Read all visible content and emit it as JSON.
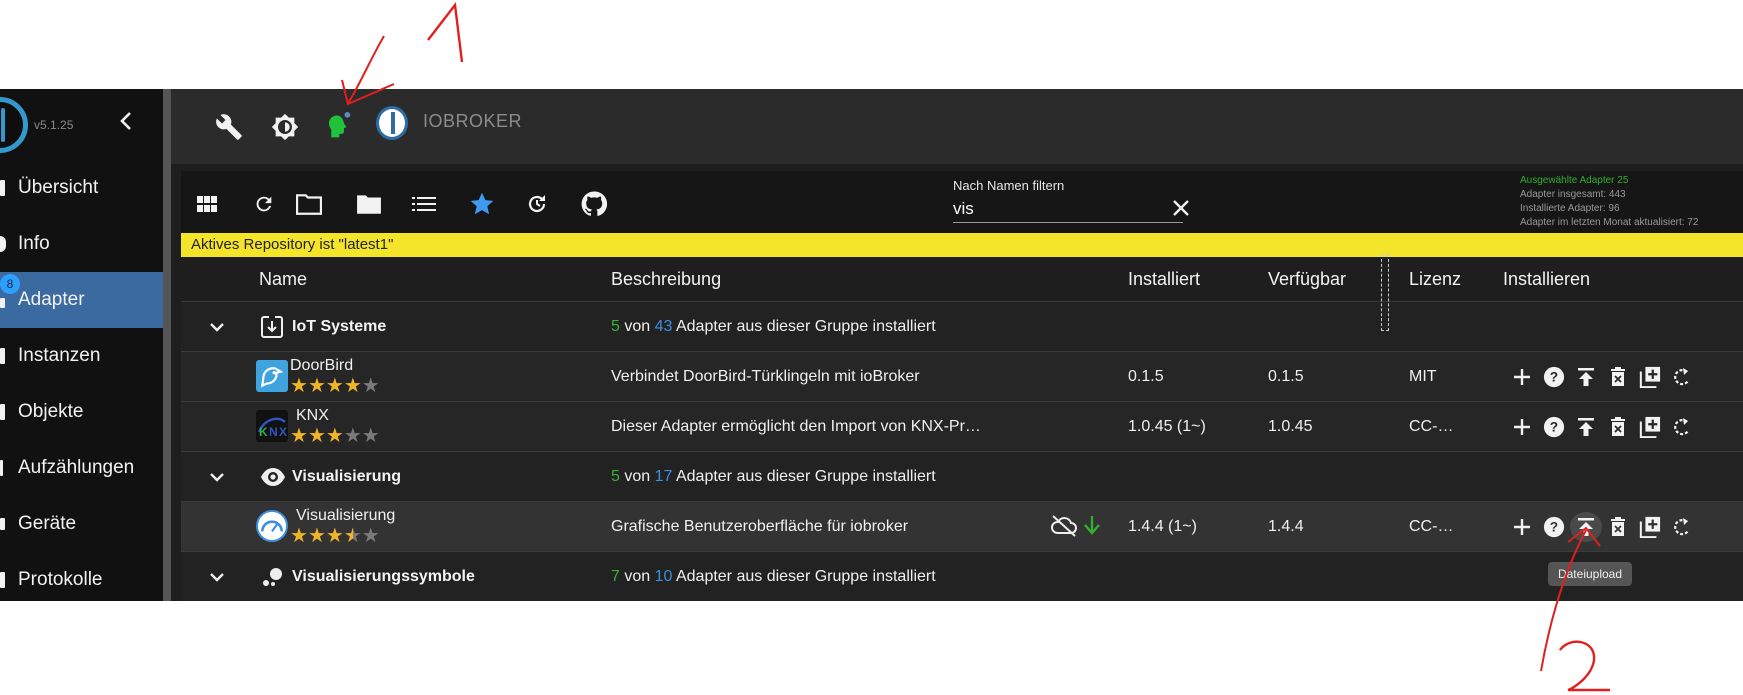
{
  "sidebar": {
    "version": "v5.1.25",
    "collapse_icon": "chevron-left-icon",
    "items": [
      {
        "label": "Übersicht",
        "icon": "list-icon",
        "active": false
      },
      {
        "label": "Info",
        "icon": "info-icon",
        "active": false
      },
      {
        "label": "Adapter",
        "icon": "adapter-icon",
        "active": true,
        "badge": "8"
      },
      {
        "label": "Instanzen",
        "icon": "instances-icon",
        "active": false
      },
      {
        "label": "Objekte",
        "icon": "objects-icon",
        "active": false
      },
      {
        "label": "Aufzählungen",
        "icon": "enums-icon",
        "active": false
      },
      {
        "label": "Geräte",
        "icon": "devices-icon",
        "active": false
      },
      {
        "label": "Protokolle",
        "icon": "logs-icon",
        "active": false
      }
    ]
  },
  "header": {
    "title": "IOBROKER",
    "icons": [
      "wrench-icon",
      "theme-toggle-icon",
      "expert-mode-icon",
      "iobroker-logo-icon"
    ]
  },
  "toolbar": {
    "icons": [
      "grid-view-icon",
      "refresh-icon",
      "folder-open-icon",
      "folder-closed-icon",
      "list-icon",
      "star-icon",
      "update-all-icon",
      "github-icon"
    ],
    "filter": {
      "label": "Nach Namen filtern",
      "value": "vis",
      "clear_icon": "close-icon"
    },
    "stats": {
      "selected": "Ausgewählte Adapter 25",
      "total": "Adapter insgesamt: 443",
      "installed": "Installierte Adapter: 96",
      "updated_month": "Adapter im letzten Monat aktualisiert: 72"
    }
  },
  "repo_banner": "Aktives Repository ist \"latest1\"",
  "table": {
    "headers": {
      "name": "Name",
      "description": "Beschreibung",
      "installed": "Installiert",
      "available": "Verfügbar",
      "license": "Lizenz",
      "install": "Installieren"
    },
    "groups": [
      {
        "title": "IoT Systeme",
        "icon": "iot-download-icon",
        "installed": "5",
        "total": "43",
        "von": "von",
        "suffix": "Adapter aus dieser Gruppe installiert"
      },
      {
        "title": "Visualisierung",
        "icon": "eye-icon",
        "installed": "5",
        "total": "17",
        "von": "von",
        "suffix": "Adapter aus dieser Gruppe installiert"
      },
      {
        "title": "Visualisierungssymbole",
        "icon": "visualization-icons-icon",
        "installed": "7",
        "total": "10",
        "von": "von",
        "suffix": "Adapter aus dieser Gruppe installiert"
      }
    ],
    "adapters": [
      {
        "name": "DoorBird",
        "icon": "doorbird-icon",
        "rating": 4,
        "description": "Verbindet DoorBird-Türklingeln mit ioBroker",
        "installed": "0.1.5",
        "available": "0.1.5",
        "license": "MIT"
      },
      {
        "name": "KNX",
        "icon": "knx-icon",
        "rating": 3,
        "description": "Dieser Adapter ermöglicht den Import von KNX-Pr…",
        "installed": "1.0.45 (1~)",
        "available": "1.0.45",
        "license": "CC-…"
      },
      {
        "name": "Visualisierung",
        "icon": "vis-gauge-icon",
        "rating": 3.5,
        "description": "Grafische Benutzeroberfläche für iobroker",
        "installed": "1.4.4 (1~)",
        "available": "1.4.4",
        "license": "CC-…",
        "status_icons": [
          "cloud-off-icon",
          "arrow-down-icon"
        ]
      }
    ],
    "row_actions": [
      "add-instance-icon",
      "help-icon",
      "upload-icon",
      "delete-icon",
      "add-box-icon",
      "update-icon"
    ]
  },
  "tooltip": "Dateiupload",
  "annotations": {
    "label_1": "1",
    "label_2": "2",
    "color": "#e02020"
  }
}
